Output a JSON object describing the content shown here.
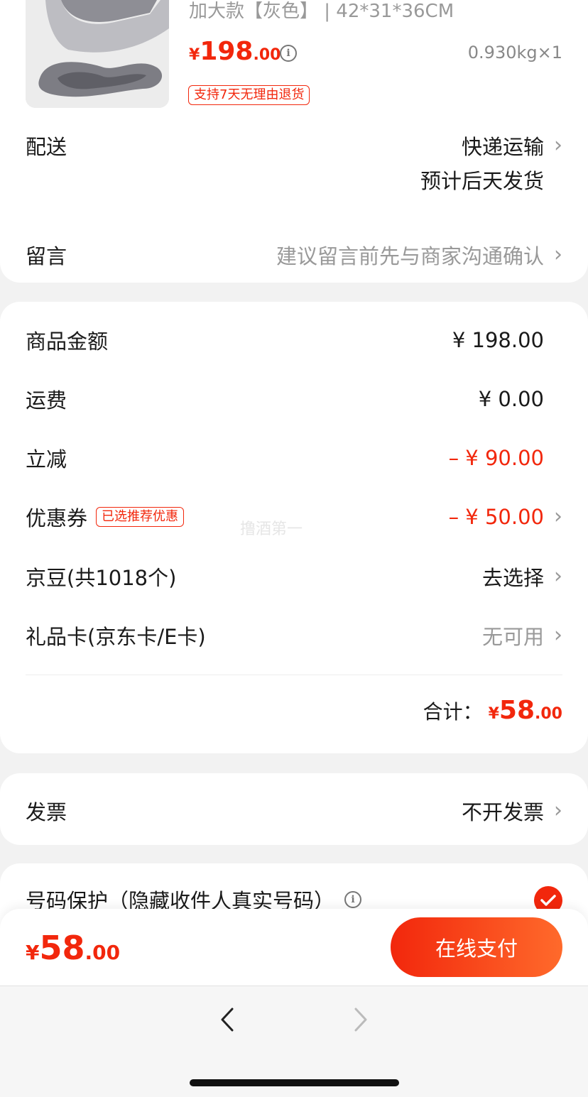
{
  "product": {
    "spec_text": "加大款【灰色】 | 42*31*36CM",
    "price_symbol": "¥",
    "price_int": "198",
    "price_dec": ".00",
    "weight_qty": "0.930kg×1",
    "return_badge": "支持7天无理由退货"
  },
  "delivery": {
    "label": "配送",
    "method": "快递运输",
    "eta": "预计后天发货"
  },
  "message": {
    "label": "留言",
    "placeholder": "建议留言前先与商家沟通确认"
  },
  "summary": {
    "goods_label": "商品金额",
    "goods_value": "¥ 198.00",
    "shipping_label": "运费",
    "shipping_value": "¥ 0.00",
    "discount_label": "立减",
    "discount_value": "– ¥ 90.00",
    "coupon_label": "优惠券",
    "coupon_badge": "已选推荐优惠",
    "coupon_value": "– ¥ 50.00",
    "beans_label": "京豆(共1018个)",
    "beans_value": "去选择",
    "giftcard_label": "礼品卡(京东卡/E卡)",
    "giftcard_value": "无可用",
    "total_label": "合计：",
    "total_symbol": "¥",
    "total_int": "58",
    "total_dec": ".00"
  },
  "watermark": "撸酒第一",
  "invoice": {
    "label": "发票",
    "value": "不开发票"
  },
  "privacy": {
    "label": "号码保护（隐藏收件人真实号码）"
  },
  "bottom_bar": {
    "price_symbol": "¥",
    "price_int": "58",
    "price_dec": ".00",
    "pay_button": "在线支付"
  },
  "nav": {
    "back_icon": "chevron-left-icon",
    "forward_icon": "chevron-right-icon"
  },
  "colors": {
    "accent_red": "#f2270c",
    "pay_gradient_start": "#f2270c",
    "pay_gradient_end": "#ff6a2b"
  }
}
